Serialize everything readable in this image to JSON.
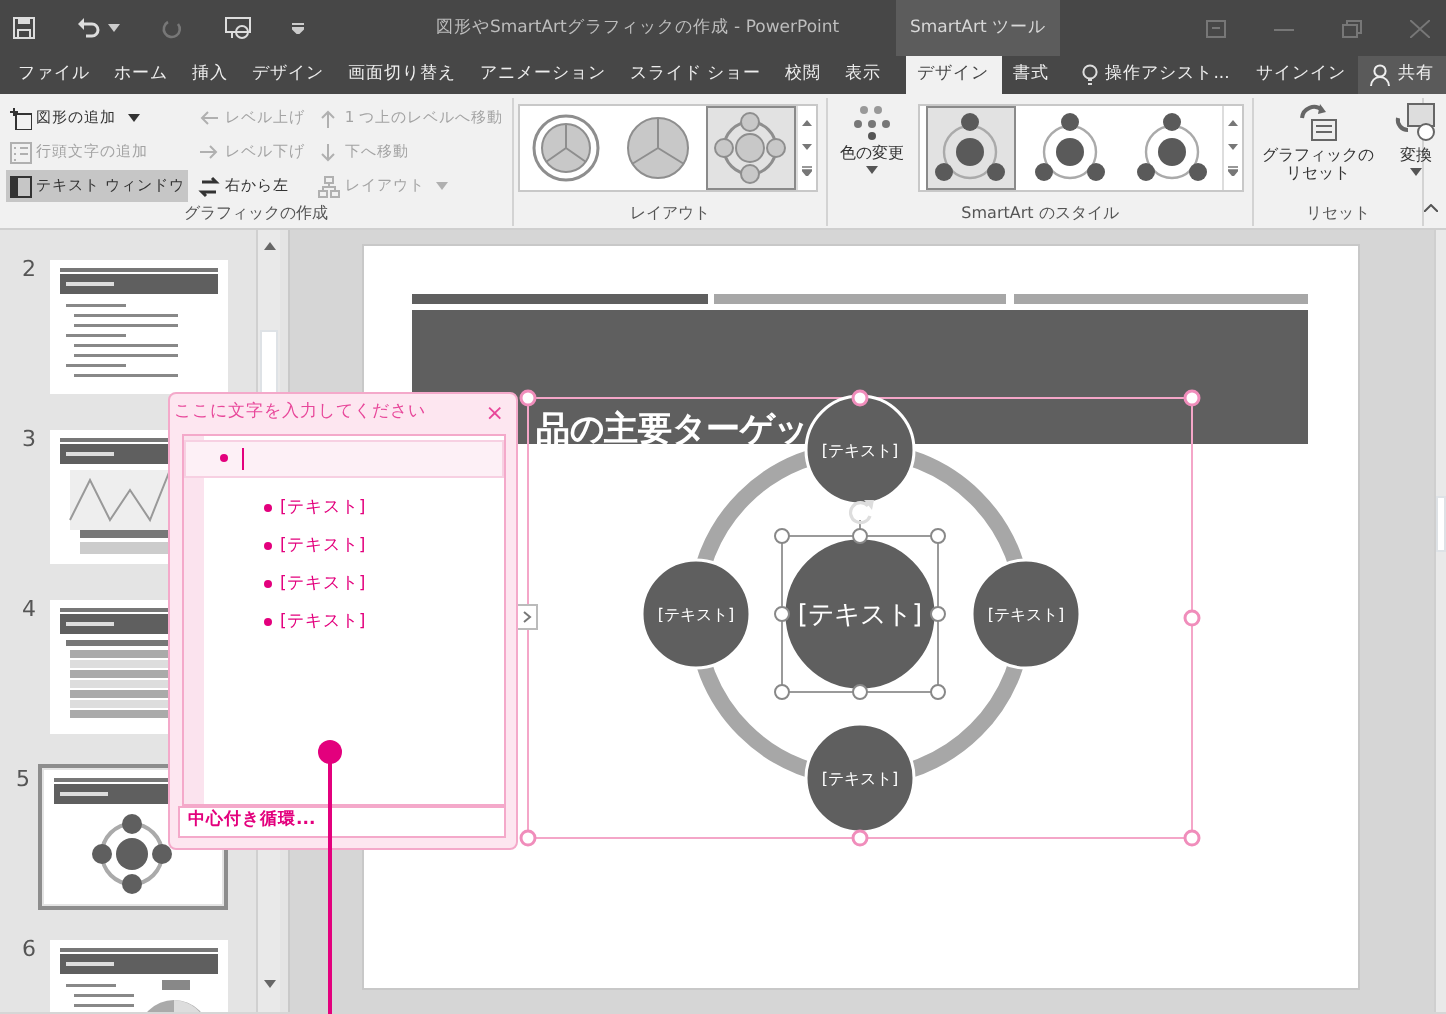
{
  "window": {
    "title": "図形やSmartArtグラフィックの作成 - PowerPoint",
    "context_tab": "SmartArt ツール"
  },
  "tabs": [
    {
      "label": "ファイル",
      "selected": false
    },
    {
      "label": "ホーム",
      "selected": false
    },
    {
      "label": "挿入",
      "selected": false
    },
    {
      "label": "デザイン",
      "selected": false
    },
    {
      "label": "画面切り替え",
      "selected": false
    },
    {
      "label": "アニメーション",
      "selected": false
    },
    {
      "label": "スライド ショー",
      "selected": false
    },
    {
      "label": "校閲",
      "selected": false
    },
    {
      "label": "表示",
      "selected": false
    },
    {
      "label": "デザイン",
      "selected": true
    },
    {
      "label": "書式",
      "selected": false
    }
  ],
  "tell_me": "操作アシスト...",
  "sign_in": "サインイン",
  "share": "共有",
  "ribbon": {
    "groups": [
      {
        "kind": "commands",
        "label": "グラフィックの作成",
        "columns": [
          [
            {
              "label": "図形の追加",
              "disabled": false,
              "dropdown": true,
              "pressed": false
            },
            {
              "label": "行頭文字の追加",
              "disabled": true,
              "dropdown": false,
              "pressed": false
            },
            {
              "label": "テキスト ウィンドウ",
              "disabled": false,
              "dropdown": false,
              "pressed": true
            }
          ],
          [
            {
              "label": "レベル上げ",
              "disabled": true,
              "dropdown": false,
              "pressed": false
            },
            {
              "label": "レベル下げ",
              "disabled": true,
              "dropdown": false,
              "pressed": false
            },
            {
              "label": "右から左",
              "disabled": false,
              "dropdown": false,
              "pressed": false
            }
          ],
          [
            {
              "label": "1 つ上のレベルへ移動",
              "disabled": true,
              "dropdown": false,
              "pressed": false
            },
            {
              "label": "下へ移動",
              "disabled": true,
              "dropdown": false,
              "pressed": false
            },
            {
              "label": "レイアウト",
              "disabled": true,
              "dropdown": true,
              "pressed": false
            }
          ]
        ]
      },
      {
        "kind": "layouts",
        "label": "レイアウト",
        "items": [
          {
            "selected": false
          },
          {
            "selected": false
          },
          {
            "selected": true
          }
        ]
      },
      {
        "kind": "styles",
        "label": "SmartArt のスタイル",
        "button": {
          "label": "色の変更",
          "dropdown": true
        },
        "items": [
          {
            "selected": true
          },
          {
            "selected": false
          },
          {
            "selected": false
          }
        ]
      },
      {
        "kind": "buttons",
        "label": "リセット",
        "buttons": [
          {
            "lines": [
              "グラフィックの",
              "リセット"
            ],
            "dropdown": false
          },
          {
            "lines": [
              "変換"
            ],
            "dropdown": true
          }
        ]
      }
    ]
  },
  "thumbnails": [
    {
      "number": "2",
      "kind": "bullets",
      "selected": false
    },
    {
      "number": "3",
      "kind": "chart",
      "selected": false
    },
    {
      "number": "4",
      "kind": "table",
      "selected": false
    },
    {
      "number": "5",
      "kind": "diagram",
      "selected": true
    },
    {
      "number": "6",
      "kind": "pie",
      "selected": false
    }
  ],
  "slide": {
    "title": "品の主要ターゲッ",
    "nodes": [
      {
        "kind": "satellite",
        "text": "[テキスト]",
        "selected": false
      },
      {
        "kind": "satellite",
        "text": "[テキスト]",
        "selected": false
      },
      {
        "kind": "center",
        "text": "[テキスト]",
        "selected": true
      },
      {
        "kind": "satellite",
        "text": "[テキスト]",
        "selected": false
      },
      {
        "kind": "satellite",
        "text": "[テキスト]",
        "selected": false
      }
    ]
  },
  "text_pane": {
    "title": "ここに文字を入力してください",
    "close": "×",
    "items": [
      {
        "selected": true,
        "children": [
          {
            "text": "[テキスト]",
            "selected": false
          },
          {
            "text": "[テキスト]",
            "selected": false
          },
          {
            "text": "[テキスト]",
            "selected": false
          },
          {
            "text": "[テキスト]",
            "selected": false
          }
        ]
      }
    ],
    "footer": "中心付き循環..."
  }
}
